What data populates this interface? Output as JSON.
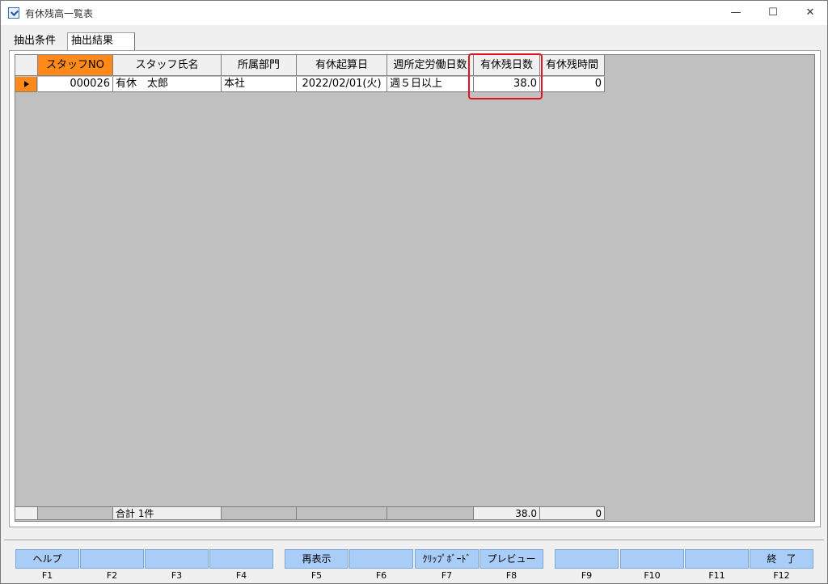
{
  "window": {
    "title": "有休残高一覧表",
    "min": "—",
    "max": "☐",
    "close": "✕"
  },
  "tabs": [
    {
      "label": "抽出条件"
    },
    {
      "label": "抽出結果"
    }
  ],
  "grid": {
    "columns": [
      "スタッフNO",
      "スタッフ氏名",
      "所属部門",
      "有休起算日",
      "週所定労働日数",
      "有休残日数",
      "有休残時間"
    ],
    "rows": [
      {
        "staff_no": "000026",
        "name": "有休　太郎",
        "dept": "本社",
        "start": "2022/02/01(火)",
        "weekdays": "週５日以上",
        "days": "38.0",
        "hours": "0"
      }
    ],
    "footer": {
      "label": "合計 1件",
      "days": "38.0",
      "hours": "0"
    }
  },
  "fkeys": [
    {
      "label": "ヘルプ",
      "key": "F1"
    },
    {
      "label": "",
      "key": "F2"
    },
    {
      "label": "",
      "key": "F3"
    },
    {
      "label": "",
      "key": "F4"
    },
    {
      "label": "再表示",
      "key": "F5"
    },
    {
      "label": "",
      "key": "F6"
    },
    {
      "label": "ｸﾘｯﾌﾟﾎﾞｰﾄﾞ",
      "key": "F7"
    },
    {
      "label": "プレビュー",
      "key": "F8"
    },
    {
      "label": "",
      "key": "F9"
    },
    {
      "label": "",
      "key": "F10"
    },
    {
      "label": "",
      "key": "F11"
    },
    {
      "label": "終　了",
      "key": "F12"
    }
  ],
  "colors": {
    "accent_orange": "#ff8a1a",
    "fkey_blue": "#a9cdf6",
    "highlight_red": "#e0141e"
  }
}
